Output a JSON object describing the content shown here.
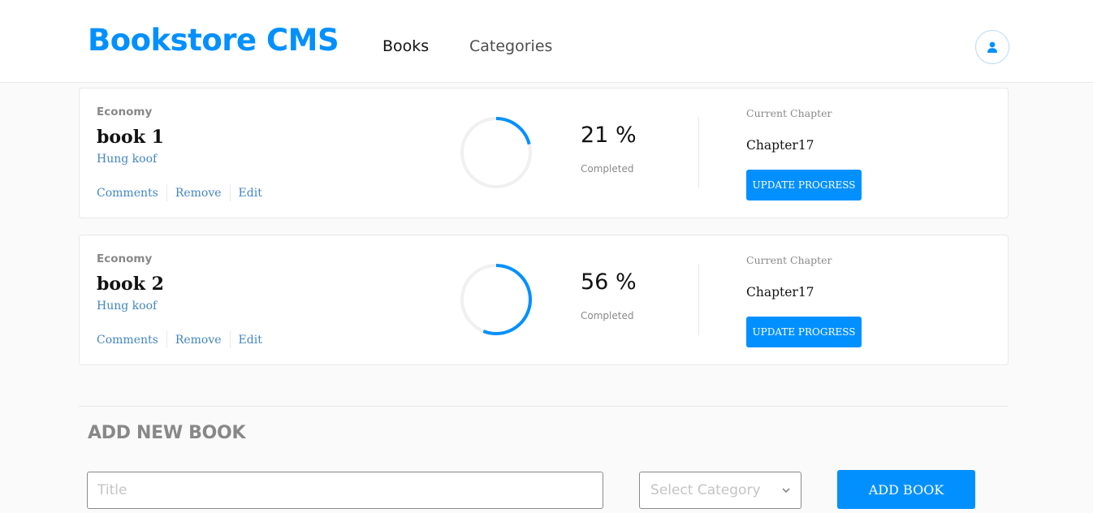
{
  "header": {
    "logo": "Bookstore CMS",
    "nav": [
      {
        "label": "Books"
      },
      {
        "label": "Categories"
      }
    ],
    "avatar_icon": "user-icon"
  },
  "books": [
    {
      "genre": "Economy",
      "title": "book 1",
      "author": "Hung koof",
      "actions": [
        "Comments",
        "Remove",
        "Edit"
      ],
      "progress": 21,
      "progress_text": "21 %",
      "completed_label": "Completed",
      "current_chapter_label": "Current Chapter",
      "current_chapter": "Chapter17",
      "update_label": "UPDATE PROGRESS"
    },
    {
      "genre": "Economy",
      "title": "book 2",
      "author": "Hung koof",
      "actions": [
        "Comments",
        "Remove",
        "Edit"
      ],
      "progress": 56,
      "progress_text": "56 %",
      "completed_label": "Completed",
      "current_chapter_label": "Current Chapter",
      "current_chapter": "Chapter17",
      "update_label": "UPDATE PROGRESS"
    }
  ],
  "add_book": {
    "heading": "ADD NEW BOOK",
    "title_placeholder": "Title",
    "category_placeholder": "Select Category",
    "button_label": "ADD BOOK"
  },
  "colors": {
    "accent": "#0290ff",
    "link": "#4386bf",
    "ring_track": "#f0f0f0"
  }
}
